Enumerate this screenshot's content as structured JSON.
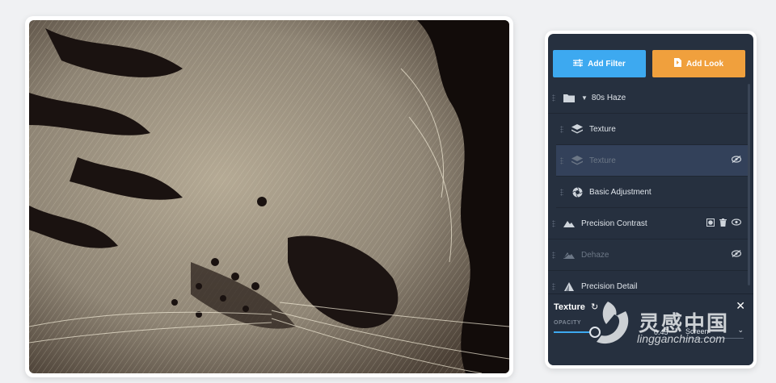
{
  "toolbar": {
    "add_filter_label": "Add Filter",
    "add_look_label": "Add Look",
    "add_filter_color": "#3da9f0",
    "add_look_color": "#f0a03d"
  },
  "layers": [
    {
      "label": "80s Haze",
      "icon": "folder-icon",
      "state": "expanded-group"
    },
    {
      "label": "Texture",
      "icon": "layers-icon",
      "state": "normal"
    },
    {
      "label": "Texture",
      "icon": "layers-icon",
      "state": "hidden-selected"
    },
    {
      "label": "Basic Adjustment",
      "icon": "aperture-icon",
      "state": "normal"
    },
    {
      "label": "Precision Contrast",
      "icon": "mountain-icon",
      "state": "normal"
    },
    {
      "label": "Dehaze",
      "icon": "dehaze-icon",
      "state": "hidden"
    },
    {
      "label": "Precision Detail",
      "icon": "triangle-icon",
      "state": "normal"
    }
  ],
  "footer": {
    "title": "Texture",
    "opacity_label": "OPACITY",
    "opacity_value": "0.45",
    "blend_mode": "Screen"
  },
  "watermark": {
    "text_cn": "灵感中国",
    "url": "lingganchina.com"
  }
}
